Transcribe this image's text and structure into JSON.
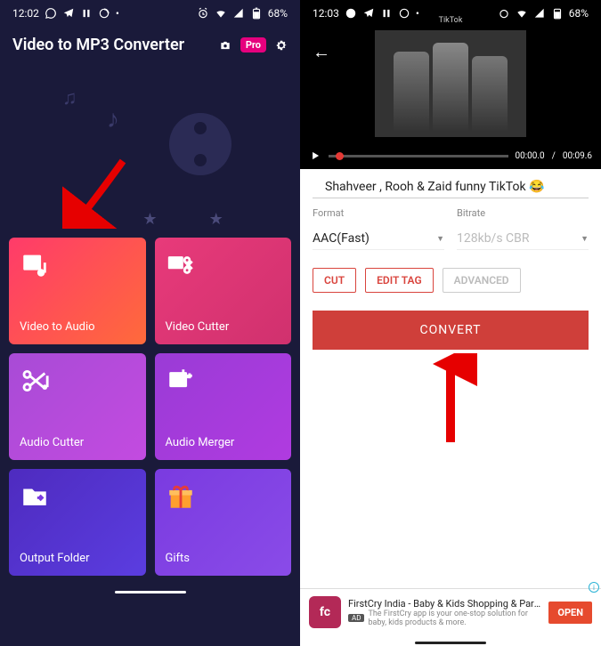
{
  "left": {
    "status": {
      "time": "12:02",
      "battery": "68%"
    },
    "title": "Video to MP3 Converter",
    "pro": "Pro",
    "tiles": [
      {
        "label": "Video to Audio"
      },
      {
        "label": "Video Cutter"
      },
      {
        "label": "Audio Cutter"
      },
      {
        "label": "Audio Merger"
      },
      {
        "label": "Output Folder"
      },
      {
        "label": "Gifts"
      }
    ]
  },
  "right": {
    "status": {
      "time": "12:03",
      "battery": "68%"
    },
    "miniTitle": "TikTok",
    "player": {
      "current": "00:00.0",
      "total": "00:09.6"
    },
    "videoTitle": "Shahveer , Rooh & Zaid funny TikTok 😂",
    "formatLabel": "Format",
    "bitrateLabel": "Bitrate",
    "formatValue": "AAC(Fast)",
    "bitrateValue": "128kb/s CBR",
    "buttons": {
      "cut": "CUT",
      "editTag": "EDIT TAG",
      "advanced": "ADVANCED"
    },
    "convert": "CONVERT",
    "ad": {
      "brand": "fc",
      "title": "FirstCry India - Baby & Kids Shopping & Pare…",
      "badge": "AD",
      "subtitle": "The FirstCry app is your one-stop solution for baby, kids products & more.",
      "cta": "OPEN"
    }
  }
}
